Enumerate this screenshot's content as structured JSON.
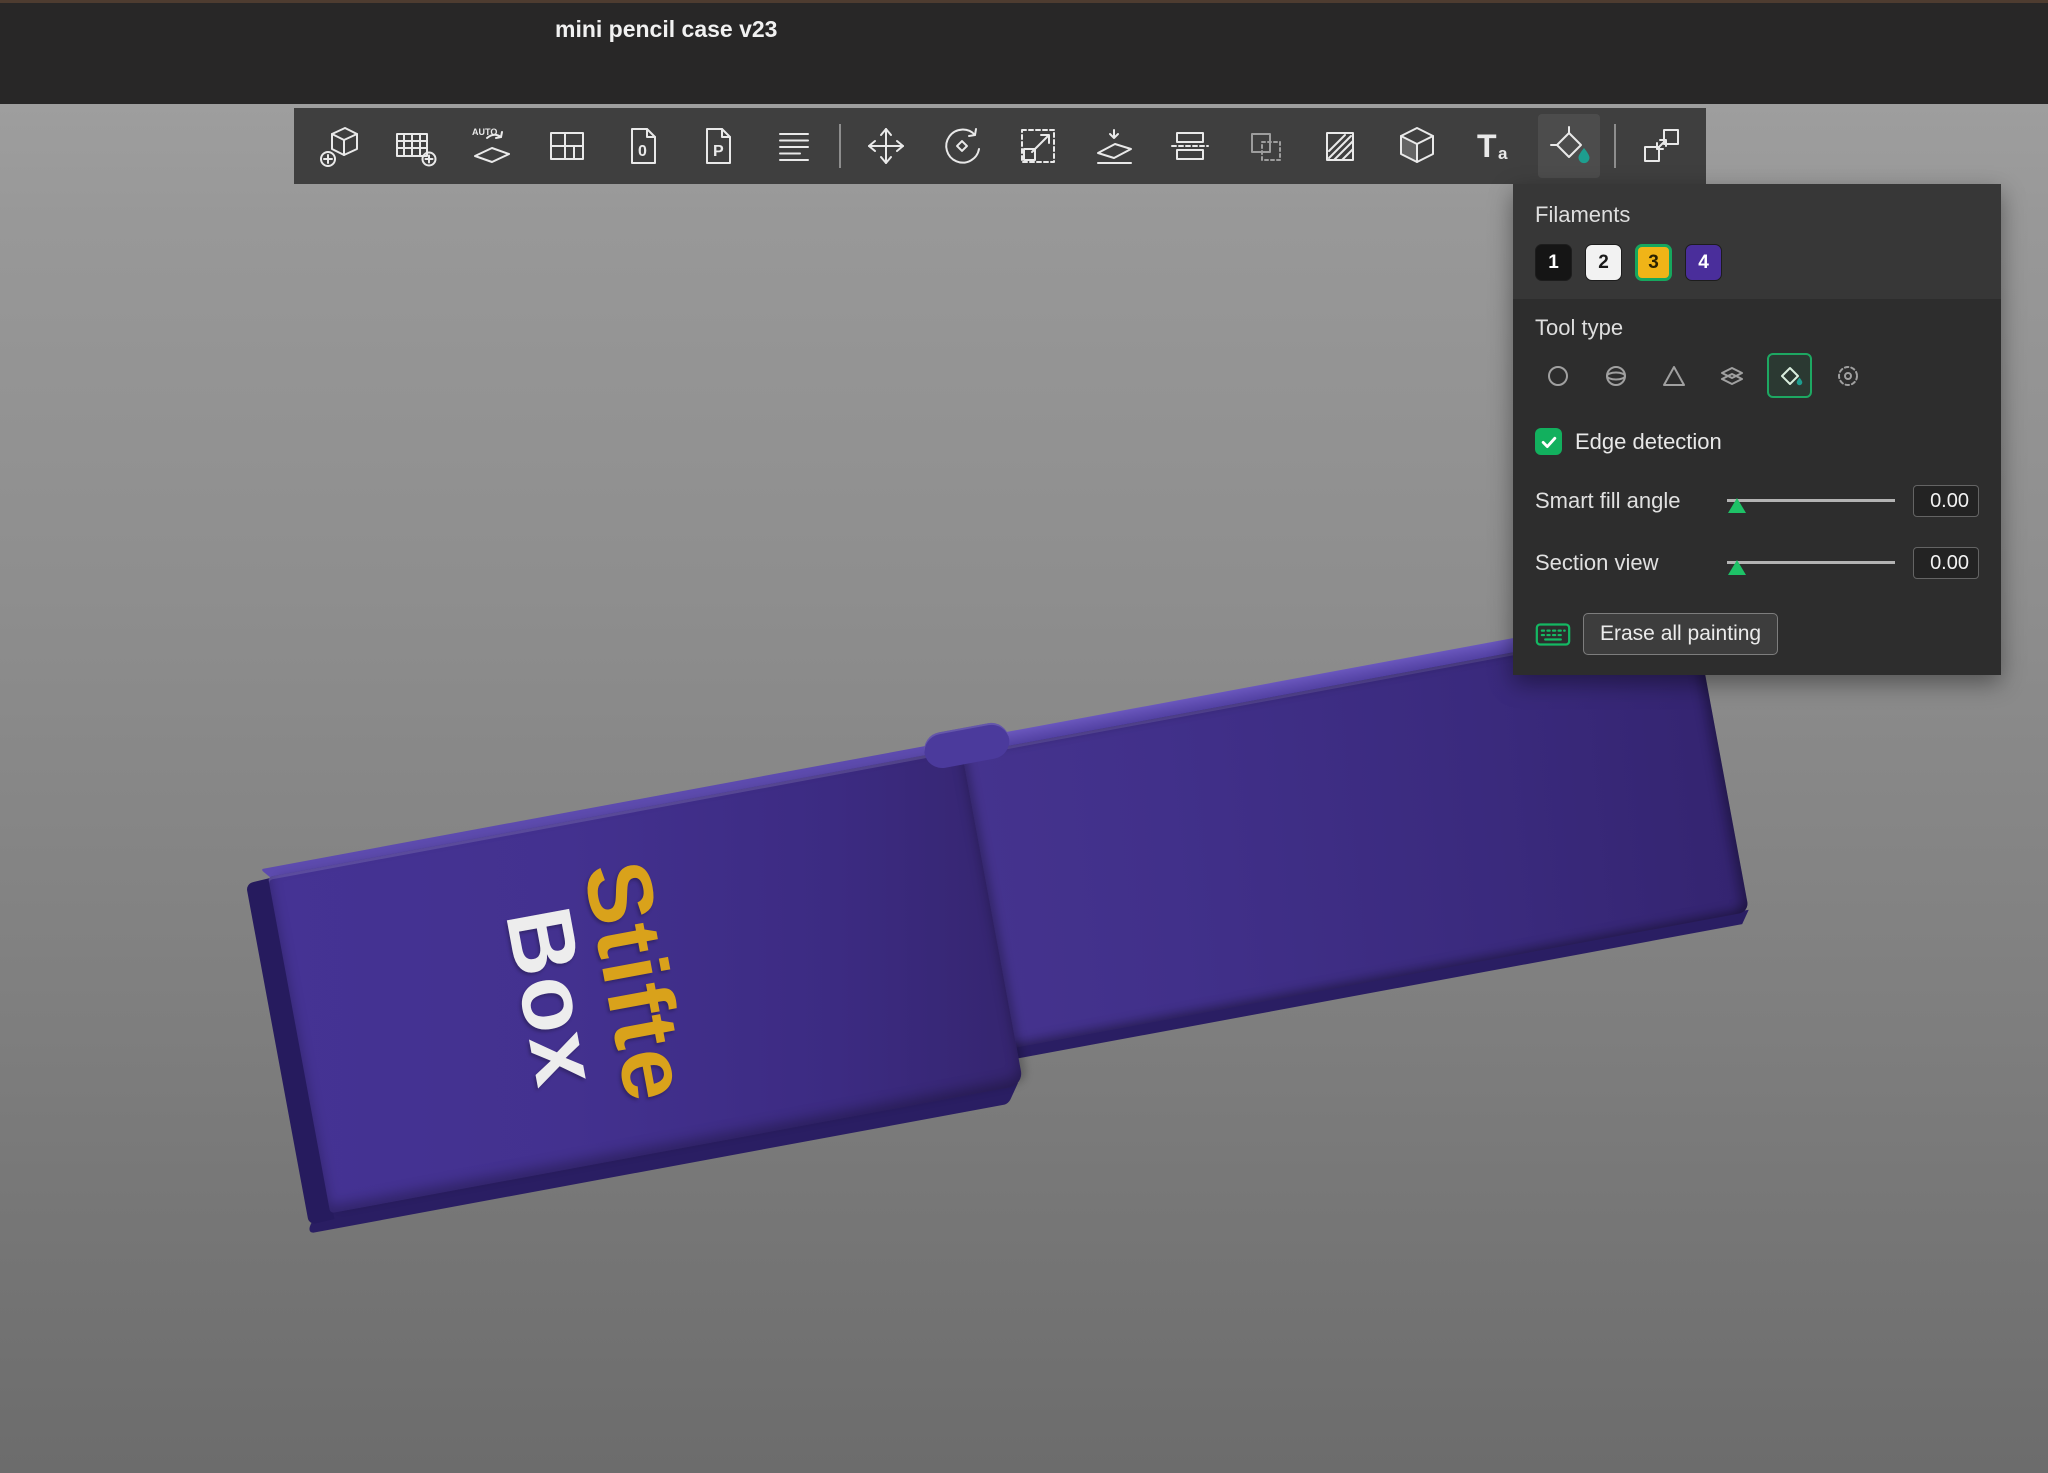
{
  "window": {
    "title": "mini pencil case v23"
  },
  "toolbar": {
    "items": [
      {
        "name": "add-object"
      },
      {
        "name": "add-plate"
      },
      {
        "name": "auto-orient",
        "glyph": "AUTO"
      },
      {
        "name": "arrange"
      },
      {
        "name": "import-geometry",
        "glyph": "0"
      },
      {
        "name": "import-page",
        "glyph": "P"
      },
      {
        "name": "object-list"
      },
      {
        "name": "move"
      },
      {
        "name": "rotate"
      },
      {
        "name": "scale"
      },
      {
        "name": "place-on-face"
      },
      {
        "name": "cut"
      },
      {
        "name": "mesh-boolean",
        "disabled": true
      },
      {
        "name": "support-paint"
      },
      {
        "name": "seam-paint"
      },
      {
        "name": "text-tool",
        "glyph_t": "T",
        "glyph_a": "a"
      },
      {
        "name": "color-paint",
        "active": true
      },
      {
        "name": "assembly"
      }
    ]
  },
  "paint_panel": {
    "filaments": {
      "label": "Filaments",
      "items": [
        {
          "id": "1",
          "color": "#151515",
          "text_color": "#ffffff",
          "selected": false
        },
        {
          "id": "2",
          "color": "#f2f2f2",
          "text_color": "#1a1a1a",
          "selected": false
        },
        {
          "id": "3",
          "color": "#f0b417",
          "text_color": "#2b2200",
          "selected": true
        },
        {
          "id": "4",
          "color": "#4a2e9b",
          "text_color": "#ffffff",
          "selected": false
        }
      ]
    },
    "tool_type": {
      "label": "Tool type",
      "tools": [
        "circle",
        "sphere",
        "triangle",
        "height-range",
        "fill",
        "gap-fill"
      ],
      "selected": "fill"
    },
    "edge_detection": {
      "label": "Edge detection",
      "checked": true
    },
    "smart_fill_angle": {
      "label": "Smart fill angle",
      "value": "0.00"
    },
    "section_view": {
      "label": "Section view",
      "value": "0.00"
    },
    "erase_button": {
      "label": "Erase all painting"
    }
  },
  "viewport": {
    "model_text_line1": "Stifte",
    "model_text_line2": "Box",
    "model_color": "#3e2d88",
    "text1_color": "#d9a21b",
    "text2_color": "#ededed"
  },
  "colors": {
    "accent_green": "#12b05e",
    "slider_thumb_green": "#1ec267",
    "droplet_teal": "#1d9e8f",
    "keyboard_icon_green": "#14b863"
  }
}
